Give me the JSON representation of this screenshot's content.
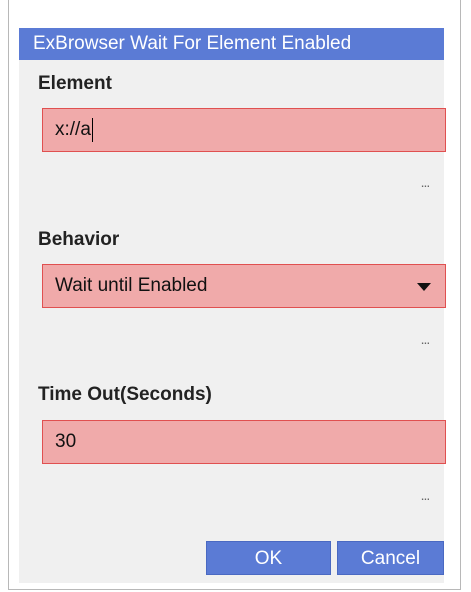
{
  "dialog": {
    "title": "ExBrowser Wait For Element Enabled"
  },
  "fields": {
    "element": {
      "label": "Element",
      "value": "x://a"
    },
    "behavior": {
      "label": "Behavior",
      "value": "Wait until Enabled"
    },
    "timeout": {
      "label": "Time Out(Seconds)",
      "value": "30"
    }
  },
  "ellipsis_label": "...",
  "buttons": {
    "ok": "OK",
    "cancel": "Cancel"
  },
  "colors": {
    "title_bar": "#5b7bd5",
    "field_background": "#f0aaaa",
    "field_border": "#e05050",
    "dialog_background": "#f0f0f0"
  }
}
